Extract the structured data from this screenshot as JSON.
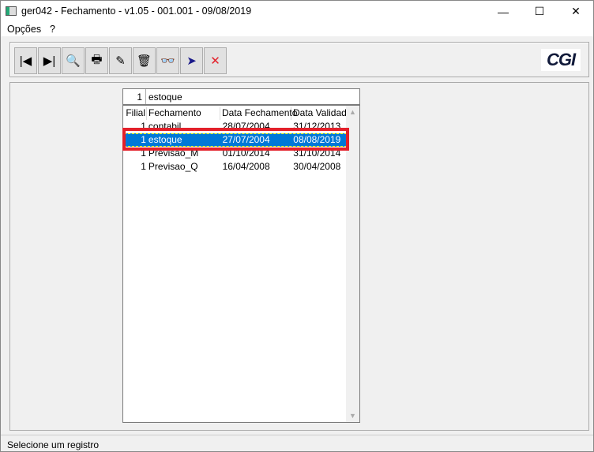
{
  "window": {
    "title": "ger042 - Fechamento - v1.05 - 001.001 - 09/08/2019",
    "minimize": "—",
    "maximize": "☐",
    "close": "✕"
  },
  "menu": [
    "Opções",
    "?"
  ],
  "toolbar": [
    {
      "icon": "first-record-icon",
      "glyph": "|◀"
    },
    {
      "icon": "last-record-icon",
      "glyph": "▶|"
    },
    {
      "icon": "search-icon",
      "glyph": "🔍"
    },
    {
      "icon": "print-icon",
      "glyph": "🖶"
    },
    {
      "icon": "edit-icon",
      "glyph": "✎"
    },
    {
      "icon": "delete-icon",
      "glyph": "🗑"
    },
    {
      "icon": "binoculars-icon",
      "glyph": "👓"
    },
    {
      "icon": "filter-icon",
      "glyph": "➤"
    },
    {
      "icon": "cancel-icon",
      "glyph": "✕"
    }
  ],
  "logo": "CGI",
  "search": {
    "filial": "1",
    "value": "estoque"
  },
  "grid": {
    "columns": [
      "Filial",
      "Fechamento",
      "Data Fechamento",
      "Data Validade"
    ],
    "rows": [
      [
        "1",
        "contabil",
        "28/07/2004",
        "31/12/2013"
      ],
      [
        "1",
        "estoque",
        "27/07/2004",
        "08/08/2019"
      ],
      [
        "1",
        "Previsao_M",
        "01/10/2014",
        "31/10/2014"
      ],
      [
        "1",
        "Previsao_Q",
        "16/04/2008",
        "30/04/2008"
      ]
    ],
    "selected_index": 1
  },
  "colors": {
    "selection": "#0078d7",
    "highlight": "#e3202a"
  },
  "status": "Selecione um registro"
}
